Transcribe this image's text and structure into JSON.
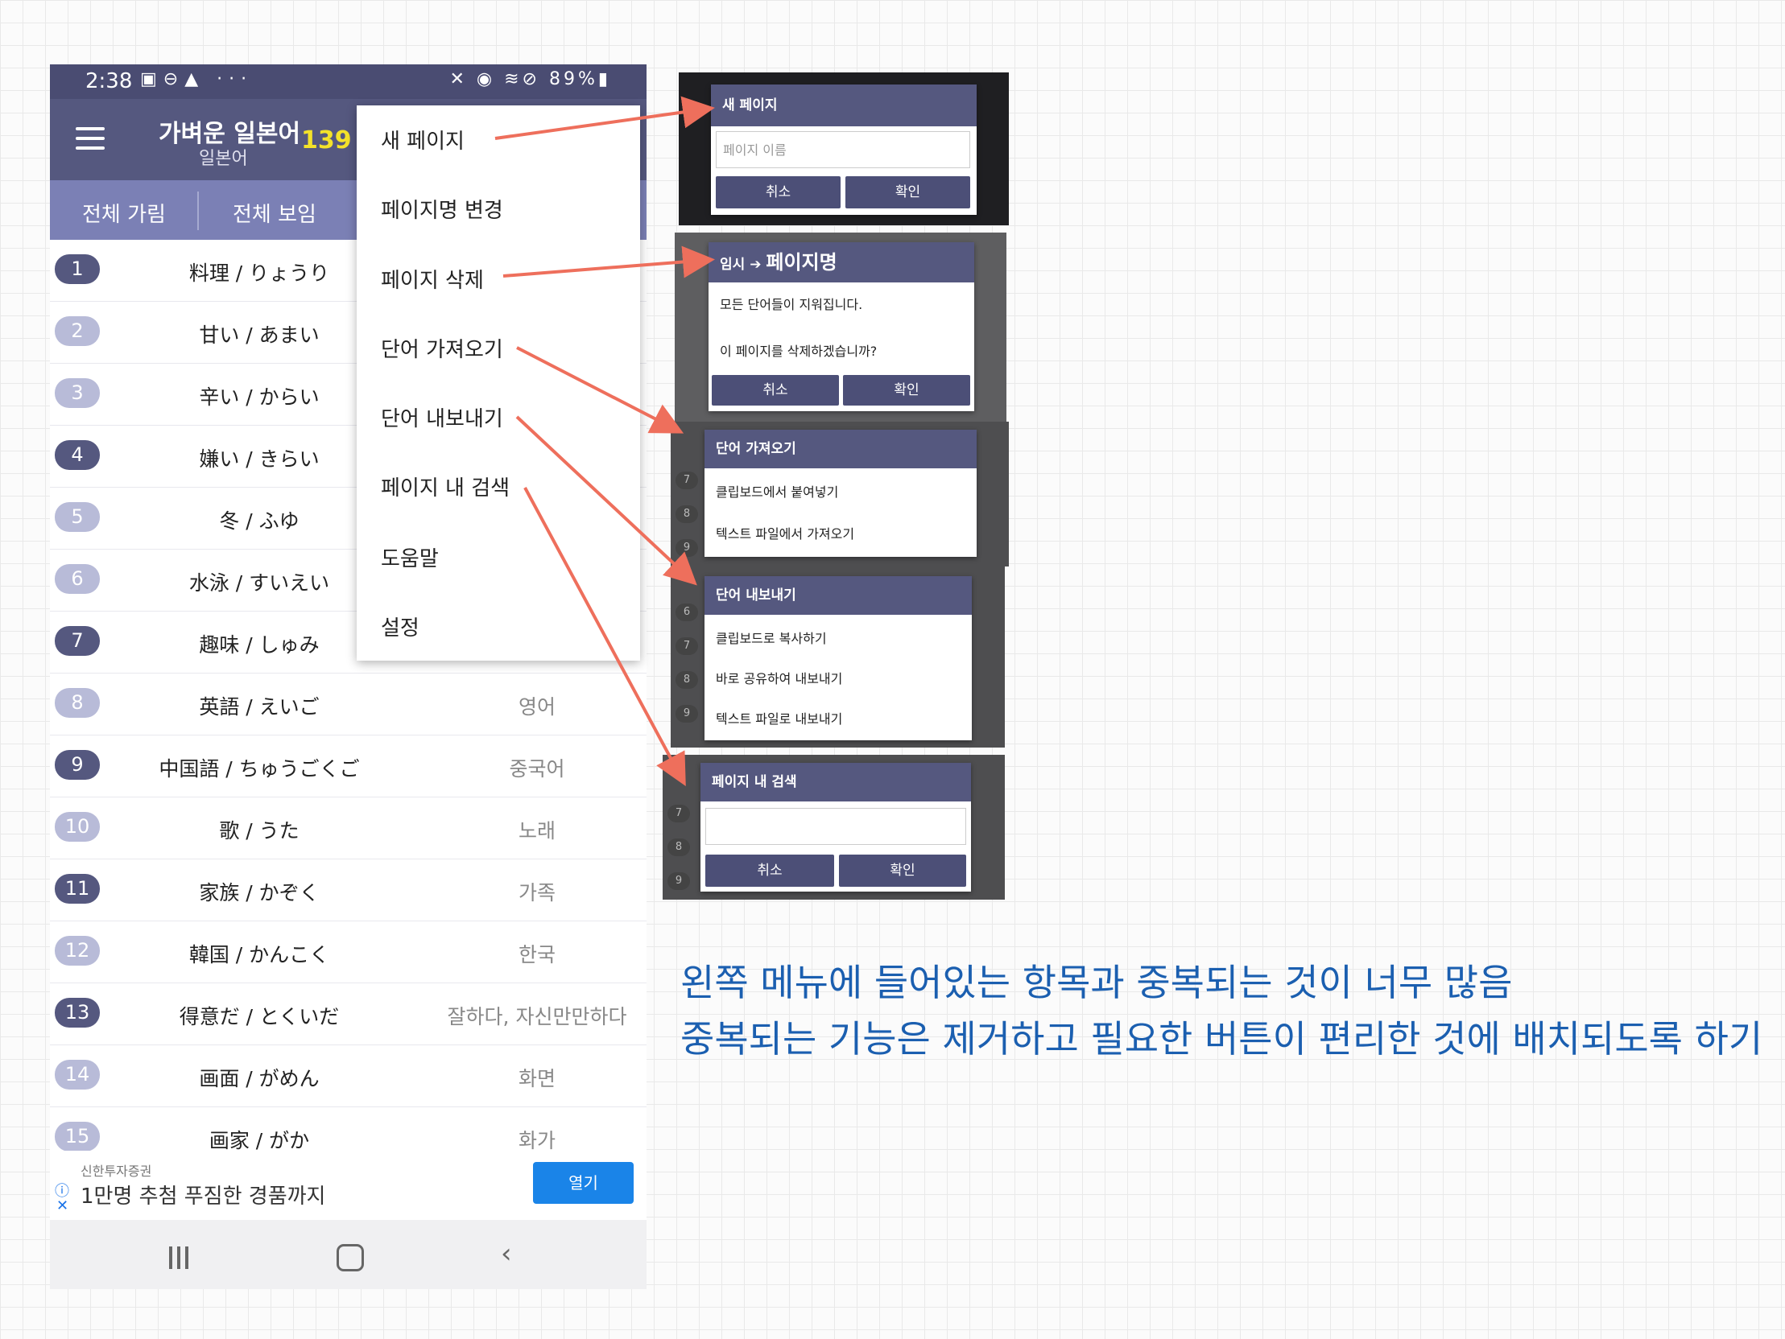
{
  "status_bar": {
    "time": "2:38",
    "battery": "89%"
  },
  "app_bar": {
    "title": "가벼운 일본어",
    "subtitle": "일본어",
    "count": "139"
  },
  "sub_bar": {
    "hide_all": "전체 가림",
    "show_all": "전체 보임"
  },
  "words": [
    {
      "num": "1",
      "word": "料理 / りょうり",
      "meaning": ""
    },
    {
      "num": "2",
      "word": "甘い / あまい",
      "meaning": ""
    },
    {
      "num": "3",
      "word": "辛い / からい",
      "meaning": ""
    },
    {
      "num": "4",
      "word": "嫌い / きらい",
      "meaning": ""
    },
    {
      "num": "5",
      "word": "冬 / ふゆ",
      "meaning": ""
    },
    {
      "num": "6",
      "word": "水泳 / すいえい",
      "meaning": ""
    },
    {
      "num": "7",
      "word": "趣味 / しゅみ",
      "meaning": ""
    },
    {
      "num": "8",
      "word": "英語 / えいご",
      "meaning": "영어"
    },
    {
      "num": "9",
      "word": "中国語 / ちゅうごくご",
      "meaning": "중국어"
    },
    {
      "num": "10",
      "word": "歌 / うた",
      "meaning": "노래"
    },
    {
      "num": "11",
      "word": "家族 / かぞく",
      "meaning": "가족"
    },
    {
      "num": "12",
      "word": "韓国 / かんこく",
      "meaning": "한국"
    },
    {
      "num": "13",
      "word": "得意だ / とくいだ",
      "meaning": "잘하다, 자신만만하다"
    },
    {
      "num": "14",
      "word": "画面 / がめん",
      "meaning": "화면"
    },
    {
      "num": "15",
      "word": "画家 / がか",
      "meaning": "화가"
    }
  ],
  "ad": {
    "source": "신한투자증권",
    "text": "1만명 추첨 푸짐한 경품까지",
    "open_label": "열기"
  },
  "menu": {
    "new_page": "새 페이지",
    "rename_page": "페이지명 변경",
    "delete_page": "페이지 삭제",
    "import_words": "단어 가져오기",
    "export_words": "단어 내보내기",
    "search_page": "페이지 내 검색",
    "help": "도움말",
    "settings": "설정"
  },
  "dialogs": {
    "new_page": {
      "title": "새 페이지",
      "placeholder": "페이지 이름",
      "cancel": "취소",
      "ok": "확인"
    },
    "delete_page": {
      "title_prefix": "임시",
      "title_arrow": "➔",
      "title_name": "페이지명",
      "line1": "모든 단어들이 지워집니다.",
      "line2": "이 페이지를 삭제하겠습니까?",
      "cancel": "취소",
      "ok": "확인"
    },
    "import": {
      "title": "단어 가져오기",
      "opt1": "클립보드에서 붙여넣기",
      "opt2": "텍스트 파일에서 가져오기"
    },
    "export": {
      "title": "단어 내보내기",
      "opt1": "클립보드로 복사하기",
      "opt2": "바로 공유하여 내보내기",
      "opt3": "텍스트 파일로 내보내기"
    },
    "search": {
      "title": "페이지 내 검색",
      "cancel": "취소",
      "ok": "확인"
    }
  },
  "annotation": {
    "line1": "왼쪽 메뉴에 들어있는 항목과 중복되는 것이 너무 많음",
    "line2": "중복되는 기능은 제거하고 필요한 버튼이 편리한 것에 배치되도록 하기"
  },
  "colors": {
    "primary": "#55587f",
    "accent_count": "#f4e22a",
    "arrow": "#ee6f5c",
    "annotation": "#1b5fb0"
  }
}
